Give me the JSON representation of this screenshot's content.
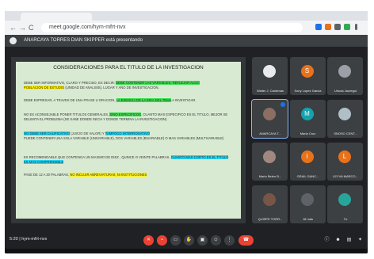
{
  "browser": {
    "url": "meet.google.com/hym-mfrt-nvx",
    "nav_back": "←",
    "nav_forward": "→",
    "nav_reload": "C"
  },
  "banner": {
    "text": "ANARCAYA TORRES DIAN SKIPPER está presentando"
  },
  "slide": {
    "title": "CONSIDERACIONES PARA EL TITULO DE LA INVESTIGACION",
    "p1_a": "DEBE SER INFORMATIVO, CLARO Y PRECISO, ES DECIR: ",
    "p1_hl": "DEBE CONTENER LAS VARIABLES, REFLEJAR ALGO",
    "p1_b": "",
    "p1_hl2": "POBLACION DE ESTUDIO",
    "p1_c": " (UNIDAD DE ANALISIS), LUGAR Y AÑO DE INVESTIGACION.",
    "p2_a": "DEBE EXPRESAR, A TRAVES DE UNA FRASE U ORACION, ",
    "p2_hl": "LA ESENCIA DE LA IDEA DEL TEMA",
    "p2_b": " A INVESTIGAR.",
    "p3_a": "NO ES ACONSEJABLE PONER TITULOS GENERALES, ",
    "p3_hl": "SINO ESPECIFICOS",
    "p3_b": ", CUANTO MAS ESPECIFICO ES EL TITULO, MEJOR SE DELIMITA EL PROBLEMA (SE SABE DONDE INICIA Y DONDE TERMINA LA INVESTIGACION)",
    "p4_hl1": "NO DEBE SER CALIFICATIVO",
    "p4_a": " (JUICIO DE VALOR) Y ",
    "p4_hl2": "TAMPOCO INTERROGATIVO",
    "p4_b": "PUEDE CONTENER UNA SOLA VARIABLE (UNIVARIABLE), DOS VARIABLES (BIVARIABLE) O MAS VARIABLES (MULTIVARIABLE)",
    "p5_a": "ES RECOMENDABLE QUE CONTENGA UN MAXIMO DE DIEZ , QUINCE O VEINTE PALABRAS. ",
    "p5_hl": "CUANTO MAS CORTO ES EL TITULO ES MAS COMPRENSIBLE",
    "p6_a": "PASE DE 12 A 20 PALABRAS, ",
    "p6_hl": "NO INCLUIR ABREVIATURAS, NI INSTITUCIONES"
  },
  "participants": [
    {
      "name": "Walter J. Cardenas",
      "letter": "",
      "color": "#e8eaed",
      "type": "photo"
    },
    {
      "name": "Sony Lopez Garcia",
      "letter": "S",
      "color": "#e8711a",
      "type": "letter"
    },
    {
      "name": "Ursula Jauregui",
      "letter": "",
      "color": "#9aa0a6",
      "type": "photo"
    },
    {
      "name": "ANARCAYA T...",
      "letter": "",
      "color": "#8d6e63",
      "type": "photo"
    },
    {
      "name": "Maria Cruz",
      "letter": "M",
      "color": "#12a4af",
      "type": "letter"
    },
    {
      "name": "SNOSO CENT...",
      "letter": "",
      "color": "#b0bec5",
      "type": "photo"
    },
    {
      "name": "Mario Belen B...",
      "letter": "",
      "color": "#a1887f",
      "type": "photo"
    },
    {
      "name": "GRAIL GANC...",
      "letter": "I",
      "color": "#e8711a",
      "type": "letter"
    },
    {
      "name": "LEYVA MARCO...",
      "letter": "L",
      "color": "#e8711a",
      "type": "letter"
    },
    {
      "name": "QUISPE TORR...",
      "letter": "",
      "color": "#795548",
      "type": "photo"
    },
    {
      "name": "18 más",
      "letter": "",
      "color": "#5f6368",
      "type": "group"
    },
    {
      "name": "Tú",
      "letter": "",
      "color": "#26a69a",
      "type": "photo"
    }
  ],
  "meeting": {
    "time_code": "5:20 | hym-mfrt-nvx"
  }
}
